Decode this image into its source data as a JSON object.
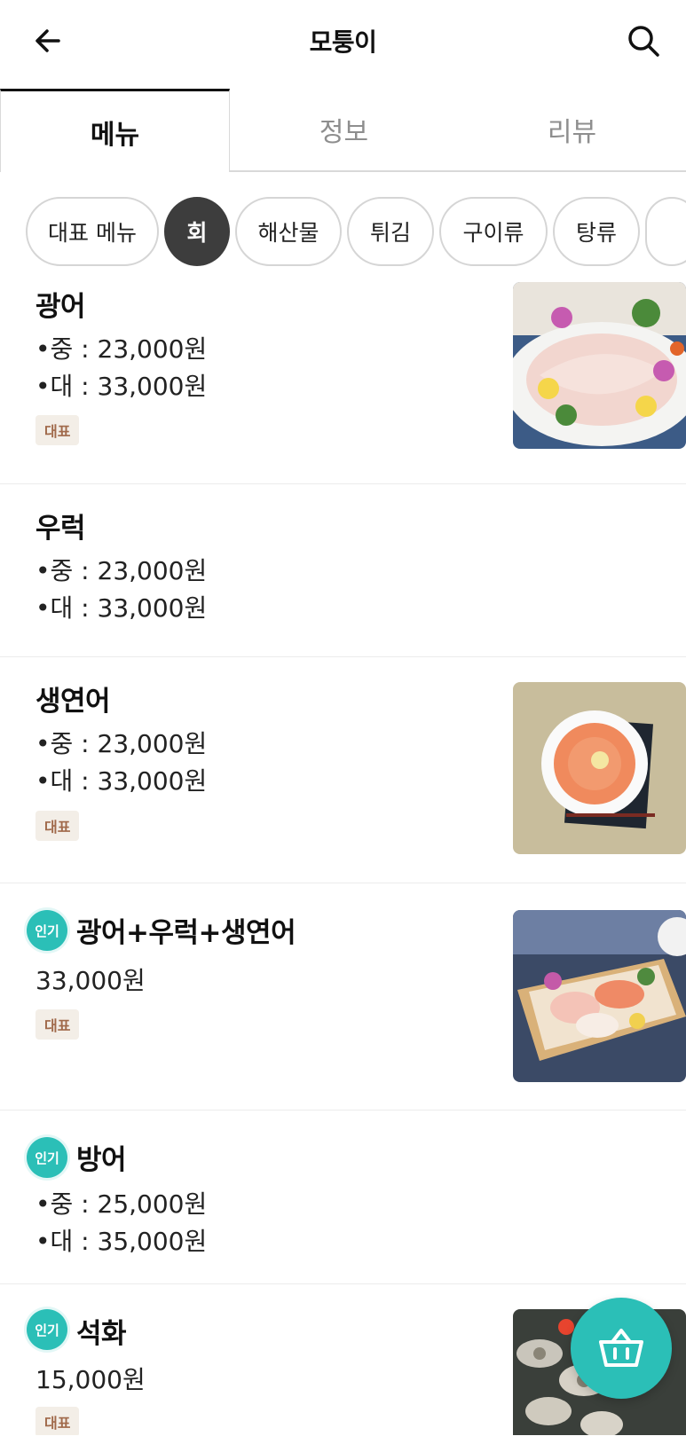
{
  "header": {
    "title": "모퉁이",
    "back_icon": "arrow-left-icon",
    "search_icon": "search-icon"
  },
  "tabs": [
    {
      "label": "메뉴",
      "active": true
    },
    {
      "label": "정보",
      "active": false
    },
    {
      "label": "리뷰",
      "active": false
    }
  ],
  "categories": [
    {
      "label": "대표 메뉴",
      "active": false
    },
    {
      "label": "회",
      "active": true
    },
    {
      "label": "해산물",
      "active": false
    },
    {
      "label": "튀김",
      "active": false
    },
    {
      "label": "구이류",
      "active": false
    },
    {
      "label": "탕류",
      "active": false
    }
  ],
  "menu_items": [
    {
      "name": "광어",
      "prices": [
        "•중 : 23,000원",
        "•대 : 33,000원"
      ],
      "tag": "대표",
      "popular": false,
      "has_image": true
    },
    {
      "name": "우럭",
      "prices": [
        "•중 : 23,000원",
        "•대 : 33,000원"
      ],
      "tag": "",
      "popular": false,
      "has_image": false
    },
    {
      "name": "생연어",
      "prices": [
        "•중 : 23,000원",
        "•대 : 33,000원"
      ],
      "tag": "대표",
      "popular": false,
      "has_image": true
    },
    {
      "name": "광어+우럭+생연어",
      "prices": [
        "33,000원"
      ],
      "tag": "대표",
      "popular": true,
      "has_image": true
    },
    {
      "name": "방어",
      "prices": [
        "•중 : 25,000원",
        "•대 : 35,000원"
      ],
      "tag": "",
      "popular": true,
      "has_image": false
    },
    {
      "name": "석화",
      "prices": [
        "15,000원"
      ],
      "tag": "대표",
      "popular": true,
      "has_image": true
    }
  ],
  "popular_badge_label": "인기",
  "cart_icon": "basket-icon",
  "colors": {
    "accent": "#2bbfb7",
    "active_chip": "#3d3d3d",
    "tag_bg": "#f3eee7",
    "tag_text": "#a0694a"
  }
}
